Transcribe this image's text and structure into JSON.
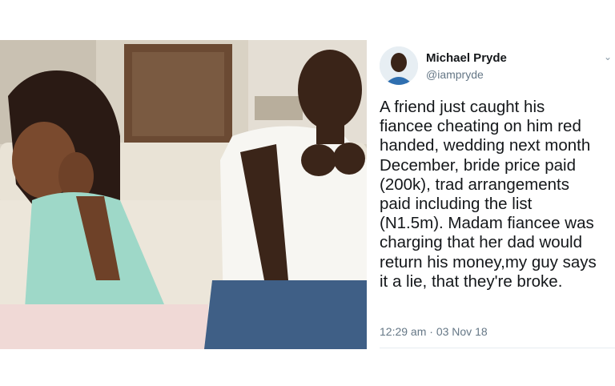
{
  "tweet": {
    "author_name": "Michael Pryde",
    "author_handle": "@iampryde",
    "text": "A friend just caught his\nfiancee cheating on him red\nhanded, wedding next month\nDecember, bride price paid\n(200k), trad arrangements\npaid including the list\n(N1.5m). Madam fiancee was\ncharging that her dad would\nreturn his money,my guy says\nit a lie, that they're broke.",
    "time": "12:29 am",
    "separator": "·",
    "date": "03 Nov 18",
    "menu_icon": "chevron-down-icon"
  },
  "colors": {
    "name": "#14171a",
    "secondary": "#657786",
    "background": "#ffffff"
  }
}
